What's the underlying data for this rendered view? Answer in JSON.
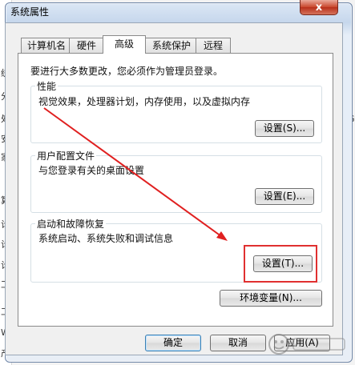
{
  "window": {
    "title": "系统属性",
    "close_glyph": "x"
  },
  "tabs": [
    {
      "label": "计算机名"
    },
    {
      "label": "硬件"
    },
    {
      "label": "高级"
    },
    {
      "label": "系统保护"
    },
    {
      "label": "远程"
    }
  ],
  "active_tab": "高级",
  "panel": {
    "admin_note": "要进行大多数更改，您必须作为管理员登录。",
    "performance": {
      "title": "性能",
      "description": "视觉效果，处理器计划，内存使用，以及虚拟内存",
      "button": "设置(S)..."
    },
    "user_profiles": {
      "title": "用户配置文件",
      "description": "与您登录有关的桌面设置",
      "button": "设置(E)..."
    },
    "startup_recovery": {
      "title": "启动和故障恢复",
      "description": "系统启动、系统失败和调试信息",
      "button": "设置(T)..."
    },
    "env_button": "环境变量(N)..."
  },
  "footer": {
    "ok": "确定",
    "cancel": "取消",
    "apply": "应用(A)"
  },
  "background_fragments": [
    "统",
    "分",
    "处",
    "安",
    "家",
    "算",
    "计",
    "计",
    "计",
    "工",
    "工",
    "W",
    "产"
  ],
  "background_right_fragment": "G",
  "annotation": {
    "arrow_color": "#e02020",
    "highlight_color": "#e03030"
  }
}
